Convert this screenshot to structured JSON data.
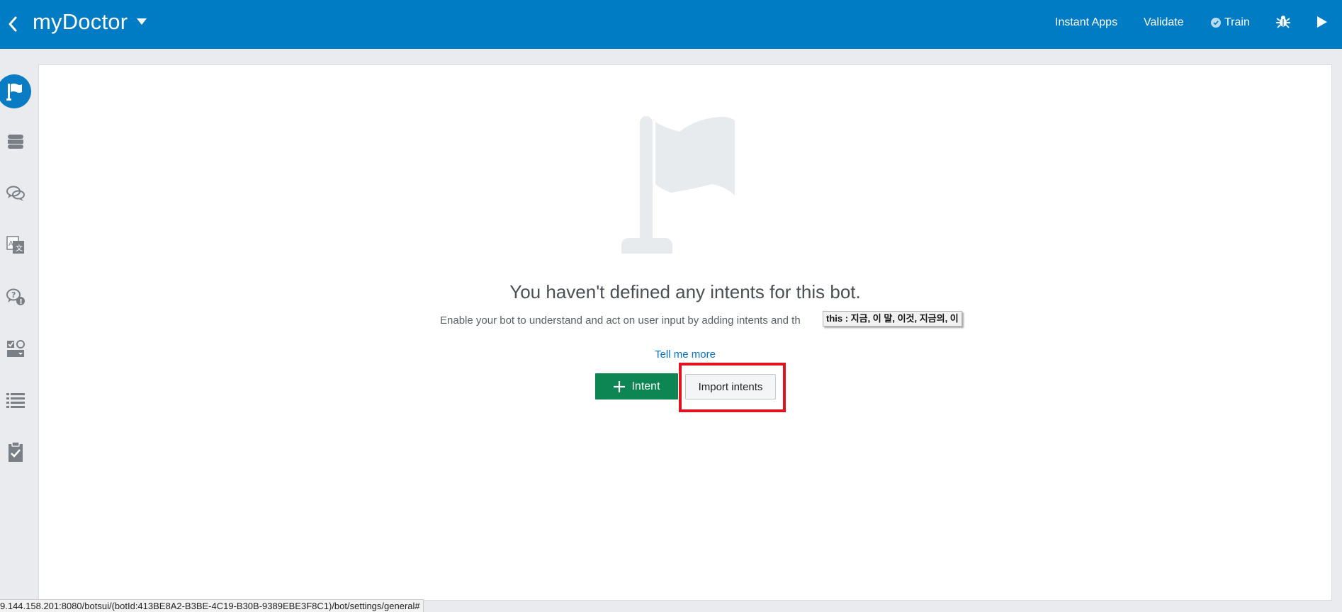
{
  "header": {
    "app_title": "myDoctor",
    "links": {
      "instant_apps": "Instant Apps",
      "validate": "Validate",
      "train": "Train"
    },
    "icons": [
      "back-icon",
      "caret-down-icon",
      "check-circle-icon",
      "bug-icon",
      "play-icon"
    ]
  },
  "sidebar": {
    "items": [
      {
        "name": "intents",
        "icon": "flag-icon",
        "active": true
      },
      {
        "name": "entities",
        "icon": "database-icon"
      },
      {
        "name": "flows",
        "icon": "chat-bubbles-icon"
      },
      {
        "name": "resource-bundles",
        "icon": "translate-icon"
      },
      {
        "name": "qna",
        "icon": "question-bubble-icon"
      },
      {
        "name": "components",
        "icon": "components-icon"
      },
      {
        "name": "logs",
        "icon": "list-icon"
      },
      {
        "name": "quality",
        "icon": "clipboard-check-icon"
      }
    ]
  },
  "empty_state": {
    "title": "You haven't defined any intents for this bot.",
    "description": "Enable your bot to understand and act on user input by adding intents and th",
    "tooltip": "this : 지금, 이 말, 이것, 지금의, 이",
    "link": "Tell me more",
    "primary_button": "Intent",
    "secondary_button": "Import intents"
  },
  "status_bar": {
    "url": "9.144.158.201:8080/botsui/(botId:413BE8A2-B3BE-4C19-B30B-9389EBE3F8C1)/bot/settings/general#"
  },
  "colors": {
    "header_bg": "#007cc4",
    "primary_button": "#0d8653",
    "highlight": "#e0141e",
    "link": "#0572ce"
  }
}
